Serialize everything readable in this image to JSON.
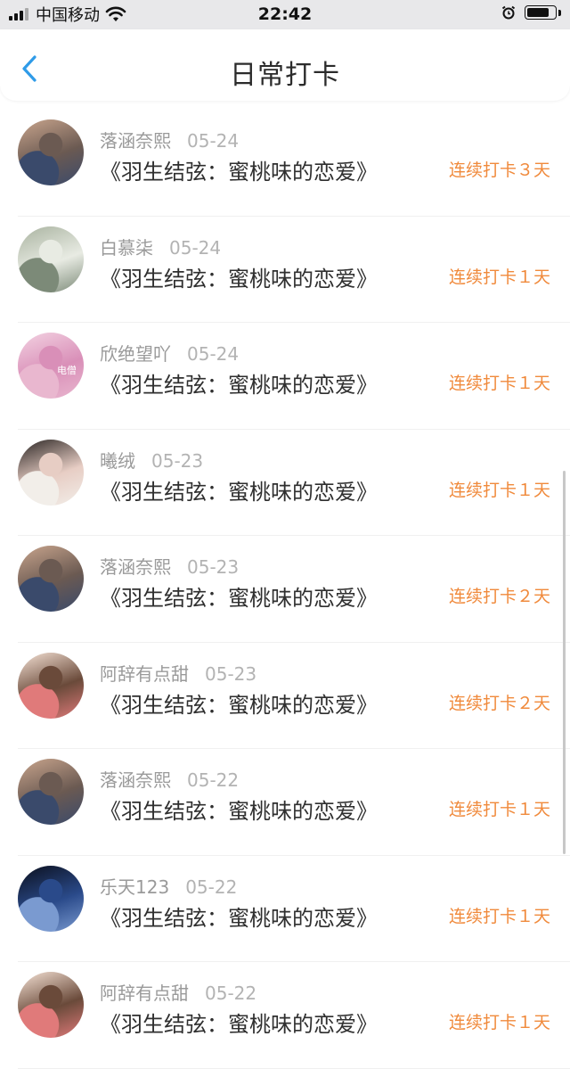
{
  "status_bar": {
    "carrier": "中国移动",
    "time": "22:42"
  },
  "header": {
    "title": "日常打卡"
  },
  "checkins": [
    {
      "user": "落涵奈熙",
      "date": "05-24",
      "book": "《羽生结弦：蜜桃味的恋爱》",
      "streak": "连续打卡３天",
      "avatar_colors": [
        "#c9a58d",
        "#6b5a52",
        "#3a4a6b"
      ]
    },
    {
      "user": "白慕柒",
      "date": "05-24",
      "book": "《羽生结弦：蜜桃味的恋爱》",
      "streak": "连续打卡１天",
      "avatar_colors": [
        "#a9b3a0",
        "#e8ebe3",
        "#7c8a78"
      ]
    },
    {
      "user": "欣绝望吖",
      "date": "05-24",
      "book": "《羽生结弦：蜜桃味的恋爱》",
      "streak": "连续打卡１天",
      "avatar_colors": [
        "#f3d3e2",
        "#d98fb8",
        "#e9b7cf"
      ],
      "avatar_text": "电僧"
    },
    {
      "user": "曦绒",
      "date": "05-23",
      "book": "《羽生结弦：蜜桃味的恋爱》",
      "streak": "连续打卡１天",
      "avatar_colors": [
        "#2a2523",
        "#e7cdc4",
        "#f2eee9"
      ]
    },
    {
      "user": "落涵奈熙",
      "date": "05-23",
      "book": "《羽生结弦：蜜桃味的恋爱》",
      "streak": "连续打卡２天",
      "avatar_colors": [
        "#c9a58d",
        "#6b5a52",
        "#3a4a6b"
      ]
    },
    {
      "user": "阿辞有点甜",
      "date": "05-23",
      "book": "《羽生结弦：蜜桃味的恋爱》",
      "streak": "连续打卡２天",
      "avatar_colors": [
        "#f6e3d6",
        "#6a4a3a",
        "#e07a7a"
      ]
    },
    {
      "user": "落涵奈熙",
      "date": "05-22",
      "book": "《羽生结弦：蜜桃味的恋爱》",
      "streak": "连续打卡１天",
      "avatar_colors": [
        "#c9a58d",
        "#6b5a52",
        "#3a4a6b"
      ]
    },
    {
      "user": "乐天123",
      "date": "05-22",
      "book": "《羽生结弦：蜜桃味的恋爱》",
      "streak": "连续打卡１天",
      "avatar_colors": [
        "#0b0f1c",
        "#2a4a8a",
        "#7a9ad0"
      ]
    },
    {
      "user": "阿辞有点甜",
      "date": "05-22",
      "book": "《羽生结弦：蜜桃味的恋爱》",
      "streak": "连续打卡１天",
      "avatar_colors": [
        "#f6e3d6",
        "#6a4a3a",
        "#e07a7a"
      ]
    }
  ],
  "colors": {
    "accent_back": "#2f9be8",
    "streak": "#f08a3c"
  }
}
